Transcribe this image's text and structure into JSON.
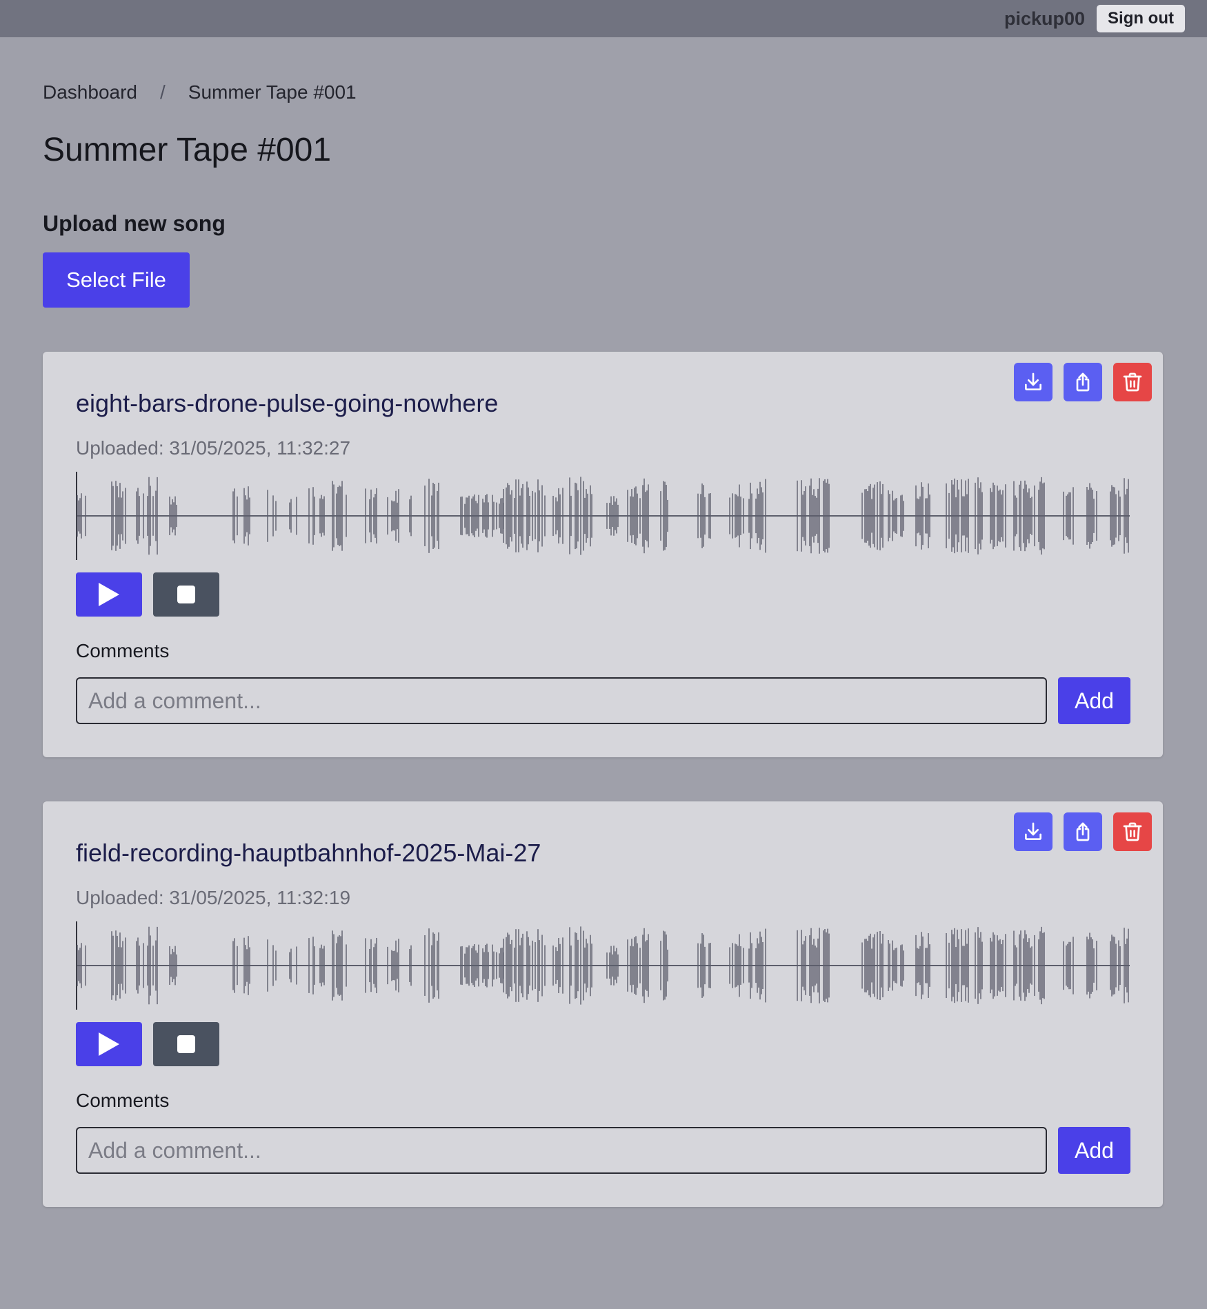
{
  "header": {
    "username": "pickup00",
    "signout_label": "Sign out"
  },
  "breadcrumb": {
    "home": "Dashboard",
    "separator": "/",
    "current": "Summer Tape #001"
  },
  "page": {
    "title": "Summer Tape #001"
  },
  "upload": {
    "heading": "Upload new song",
    "button_label": "Select File"
  },
  "colors": {
    "accent": "#4a40e8",
    "danger": "#e64646",
    "action_icon_bg": "#5b5ff2",
    "waveform": "#5d5f6c",
    "background": "#9fa0aa"
  },
  "songs": [
    {
      "title": "eight-bars-drone-pulse-going-nowhere",
      "uploaded": "Uploaded: 31/05/2025, 11:32:27",
      "actions": [
        "download-icon",
        "share-icon",
        "trash-icon"
      ],
      "player_icons": [
        "play-icon",
        "stop-icon"
      ],
      "playback_progress": 0,
      "comments_label": "Comments",
      "comment_placeholder": "Add a comment...",
      "add_label": "Add"
    },
    {
      "title": "field-recording-hauptbahnhof-2025-Mai-27",
      "uploaded": "Uploaded: 31/05/2025, 11:32:19",
      "actions": [
        "download-icon",
        "share-icon",
        "trash-icon"
      ],
      "player_icons": [
        "play-icon",
        "stop-icon"
      ],
      "playback_progress": 0,
      "comments_label": "Comments",
      "comment_placeholder": "Add a comment...",
      "add_label": "Add"
    }
  ]
}
